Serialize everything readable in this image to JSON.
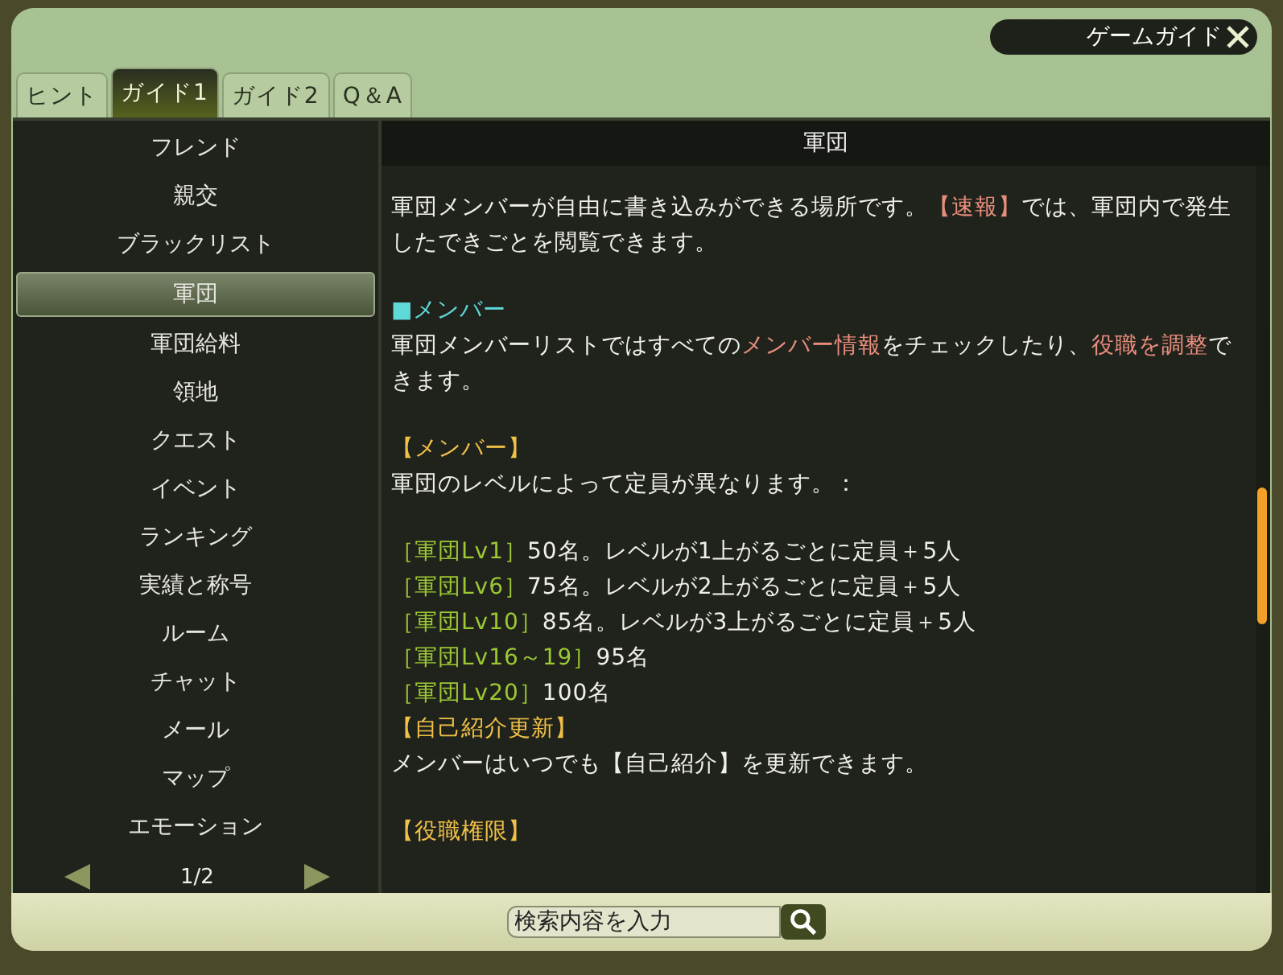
{
  "window": {
    "title": "ゲームガイド"
  },
  "tabs": [
    {
      "label": "ヒント",
      "selected": false
    },
    {
      "label": "ガイド1",
      "selected": true
    },
    {
      "label": "ガイド2",
      "selected": false
    },
    {
      "label": "Q＆A",
      "selected": false
    }
  ],
  "sidebar": {
    "items": [
      {
        "label": "フレンド",
        "selected": false
      },
      {
        "label": "親交",
        "selected": false
      },
      {
        "label": "ブラックリスト",
        "selected": false
      },
      {
        "label": "軍団",
        "selected": true
      },
      {
        "label": "軍団給料",
        "selected": false
      },
      {
        "label": "領地",
        "selected": false
      },
      {
        "label": "クエスト",
        "selected": false
      },
      {
        "label": "イベント",
        "selected": false
      },
      {
        "label": "ランキング",
        "selected": false
      },
      {
        "label": "実績と称号",
        "selected": false
      },
      {
        "label": "ルーム",
        "selected": false
      },
      {
        "label": "チャット",
        "selected": false
      },
      {
        "label": "メール",
        "selected": false
      },
      {
        "label": "マップ",
        "selected": false
      },
      {
        "label": "エモーション",
        "selected": false
      }
    ],
    "pager": "1/2"
  },
  "content": {
    "title": "軍団",
    "lines": [
      {
        "kind": "text",
        "parts": [
          {
            "text": "軍団メンバーが自由に書き込みができる場所です。",
            "kind": "plain"
          },
          {
            "text": "【速報】",
            "kind": "red"
          },
          {
            "text": "では、軍団内で発生したできごとを閲覧できます。",
            "kind": "plain"
          }
        ]
      },
      {
        "kind": "gap"
      },
      {
        "kind": "text",
        "parts": [
          {
            "text": "■メンバー",
            "kind": "cyan"
          }
        ]
      },
      {
        "kind": "text",
        "parts": [
          {
            "text": "軍団メンバーリストではすべての",
            "kind": "plain"
          },
          {
            "text": "メンバー情報",
            "kind": "red"
          },
          {
            "text": "をチェックしたり、",
            "kind": "plain"
          },
          {
            "text": "役職を調整",
            "kind": "red"
          },
          {
            "text": "できます。",
            "kind": "plain"
          }
        ]
      },
      {
        "kind": "gap"
      },
      {
        "kind": "text",
        "parts": [
          {
            "text": "【メンバー】",
            "kind": "gold"
          }
        ]
      },
      {
        "kind": "text",
        "parts": [
          {
            "text": "軍団のレベルによって定員が異なります。：",
            "kind": "plain"
          }
        ]
      },
      {
        "kind": "gap"
      },
      {
        "kind": "text",
        "parts": [
          {
            "text": "［軍団Lv1］",
            "kind": "green"
          },
          {
            "text": "50名。レベルが1上がるごとに定員＋5人",
            "kind": "plain"
          }
        ]
      },
      {
        "kind": "text",
        "parts": [
          {
            "text": "［軍団Lv6］",
            "kind": "green"
          },
          {
            "text": "75名。レベルが2上がるごとに定員＋5人",
            "kind": "plain"
          }
        ]
      },
      {
        "kind": "text",
        "parts": [
          {
            "text": "［軍団Lv10］",
            "kind": "green"
          },
          {
            "text": "85名。レベルが3上がるごとに定員＋5人",
            "kind": "plain"
          }
        ]
      },
      {
        "kind": "text",
        "parts": [
          {
            "text": "［軍団Lv16～19］",
            "kind": "green"
          },
          {
            "text": "95名",
            "kind": "plain"
          }
        ]
      },
      {
        "kind": "text",
        "parts": [
          {
            "text": "［軍団Lv20］",
            "kind": "green"
          },
          {
            "text": "100名",
            "kind": "plain"
          }
        ]
      },
      {
        "kind": "text",
        "parts": [
          {
            "text": "【自己紹介更新】",
            "kind": "gold"
          }
        ]
      },
      {
        "kind": "text",
        "parts": [
          {
            "text": "メンバーはいつでも【自己紹介】を更新できます。",
            "kind": "plain"
          }
        ]
      },
      {
        "kind": "gap"
      },
      {
        "kind": "text",
        "parts": [
          {
            "text": "【役職権限】",
            "kind": "gold"
          }
        ]
      }
    ]
  },
  "search": {
    "placeholder": "検索内容を入力"
  }
}
